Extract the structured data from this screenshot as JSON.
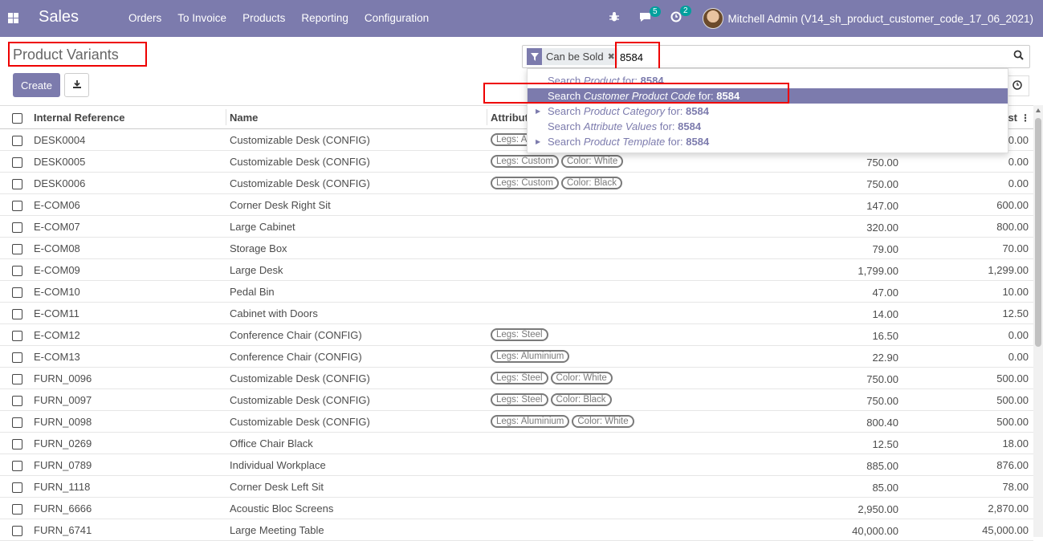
{
  "navbar": {
    "app_name": "Sales",
    "menu": [
      "Orders",
      "To Invoice",
      "Products",
      "Reporting",
      "Configuration"
    ],
    "messages_count": "5",
    "activities_count": "2",
    "user": "Mitchell Admin (V14_sh_product_customer_code_17_06_2021)",
    "brand_color": "#7c7bad"
  },
  "control_panel": {
    "title": "Product Variants",
    "create_label": "Create"
  },
  "search": {
    "facet": "Can be Sold",
    "query": "8584",
    "options": [
      {
        "prefix": "Search ",
        "field": "Product",
        "suffix": " for: ",
        "value": "8584",
        "expandable": false,
        "active": false
      },
      {
        "prefix": "Search ",
        "field": "Customer Product Code",
        "suffix": " for: ",
        "value": "8584",
        "expandable": false,
        "active": true
      },
      {
        "prefix": "Search ",
        "field": "Product Category",
        "suffix": " for: ",
        "value": "8584",
        "expandable": true,
        "active": false
      },
      {
        "prefix": "Search ",
        "field": "Attribute Values",
        "suffix": " for: ",
        "value": "8584",
        "expandable": false,
        "active": false
      },
      {
        "prefix": "Search ",
        "field": "Product Template",
        "suffix": " for: ",
        "value": "8584",
        "expandable": true,
        "active": false
      }
    ]
  },
  "table": {
    "headers": {
      "ref": "Internal Reference",
      "name": "Name",
      "attributes": "Attribut",
      "cost": "st"
    },
    "rows": [
      {
        "ref": "DESK0004",
        "name": "Customizable Desk (CONFIG)",
        "tags": [
          "Legs: A"
        ],
        "price": "",
        "cost": "0.00"
      },
      {
        "ref": "DESK0005",
        "name": "Customizable Desk (CONFIG)",
        "tags": [
          "Legs: Custom",
          "Color: White"
        ],
        "price": "750.00",
        "cost": "0.00"
      },
      {
        "ref": "DESK0006",
        "name": "Customizable Desk (CONFIG)",
        "tags": [
          "Legs: Custom",
          "Color: Black"
        ],
        "price": "750.00",
        "cost": "0.00"
      },
      {
        "ref": "E-COM06",
        "name": "Corner Desk Right Sit",
        "tags": [],
        "price": "147.00",
        "cost": "600.00"
      },
      {
        "ref": "E-COM07",
        "name": "Large Cabinet",
        "tags": [],
        "price": "320.00",
        "cost": "800.00"
      },
      {
        "ref": "E-COM08",
        "name": "Storage Box",
        "tags": [],
        "price": "79.00",
        "cost": "70.00"
      },
      {
        "ref": "E-COM09",
        "name": "Large Desk",
        "tags": [],
        "price": "1,799.00",
        "cost": "1,299.00"
      },
      {
        "ref": "E-COM10",
        "name": "Pedal Bin",
        "tags": [],
        "price": "47.00",
        "cost": "10.00"
      },
      {
        "ref": "E-COM11",
        "name": "Cabinet with Doors",
        "tags": [],
        "price": "14.00",
        "cost": "12.50"
      },
      {
        "ref": "E-COM12",
        "name": "Conference Chair (CONFIG)",
        "tags": [
          "Legs: Steel"
        ],
        "price": "16.50",
        "cost": "0.00"
      },
      {
        "ref": "E-COM13",
        "name": "Conference Chair (CONFIG)",
        "tags": [
          "Legs: Aluminium"
        ],
        "price": "22.90",
        "cost": "0.00"
      },
      {
        "ref": "FURN_0096",
        "name": "Customizable Desk (CONFIG)",
        "tags": [
          "Legs: Steel",
          "Color: White"
        ],
        "price": "750.00",
        "cost": "500.00"
      },
      {
        "ref": "FURN_0097",
        "name": "Customizable Desk (CONFIG)",
        "tags": [
          "Legs: Steel",
          "Color: Black"
        ],
        "price": "750.00",
        "cost": "500.00"
      },
      {
        "ref": "FURN_0098",
        "name": "Customizable Desk (CONFIG)",
        "tags": [
          "Legs: Aluminium",
          "Color: White"
        ],
        "price": "800.40",
        "cost": "500.00"
      },
      {
        "ref": "FURN_0269",
        "name": "Office Chair Black",
        "tags": [],
        "price": "12.50",
        "cost": "18.00"
      },
      {
        "ref": "FURN_0789",
        "name": "Individual Workplace",
        "tags": [],
        "price": "885.00",
        "cost": "876.00"
      },
      {
        "ref": "FURN_1118",
        "name": "Corner Desk Left Sit",
        "tags": [],
        "price": "85.00",
        "cost": "78.00"
      },
      {
        "ref": "FURN_6666",
        "name": "Acoustic Bloc Screens",
        "tags": [],
        "price": "2,950.00",
        "cost": "2,870.00"
      },
      {
        "ref": "FURN_6741",
        "name": "Large Meeting Table",
        "tags": [],
        "price": "40,000.00",
        "cost": "45,000.00"
      }
    ]
  }
}
